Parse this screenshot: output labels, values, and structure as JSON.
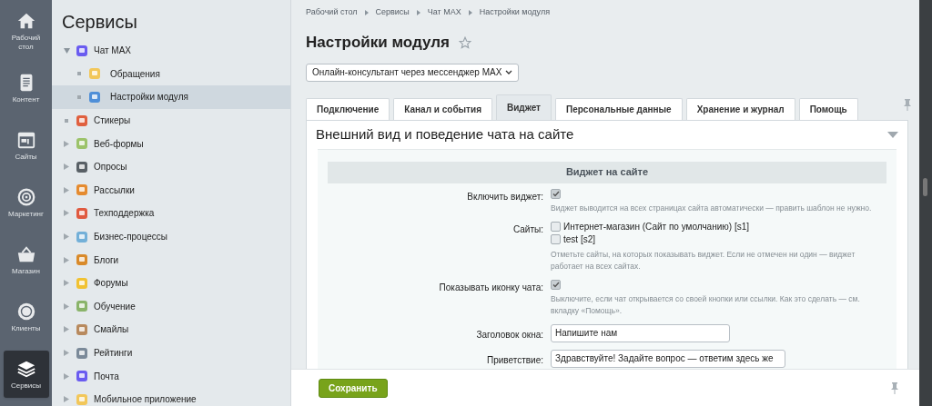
{
  "left_nav": [
    {
      "label": "Рабочий стол",
      "selected": false
    },
    {
      "label": "Контент",
      "selected": false
    },
    {
      "label": "Сайты",
      "selected": false
    },
    {
      "label": "Маркетинг",
      "selected": false
    },
    {
      "label": "Магазин",
      "selected": false
    },
    {
      "label": "Клиенты",
      "selected": false
    },
    {
      "label": "Сервисы",
      "selected": true
    }
  ],
  "sidebar": {
    "title": "Сервисы",
    "items": [
      {
        "label": "Чат MAX",
        "kind": "folder",
        "expanded": true,
        "selected": false,
        "children": [
          {
            "label": "Обращения",
            "kind": "leaf",
            "selected": false
          },
          {
            "label": "Настройки модуля",
            "kind": "leaf",
            "selected": true
          }
        ]
      },
      {
        "label": "Стикеры",
        "kind": "leaf",
        "selected": false
      },
      {
        "label": "Веб-формы",
        "kind": "folder",
        "expanded": false,
        "selected": false
      },
      {
        "label": "Опросы",
        "kind": "folder",
        "expanded": false,
        "selected": false
      },
      {
        "label": "Рассылки",
        "kind": "folder",
        "expanded": false,
        "selected": false
      },
      {
        "label": "Техподдержка",
        "kind": "folder",
        "expanded": false,
        "selected": false
      },
      {
        "label": "Бизнес-процессы",
        "kind": "folder",
        "expanded": false,
        "selected": false
      },
      {
        "label": "Блоги",
        "kind": "folder",
        "expanded": false,
        "selected": false
      },
      {
        "label": "Форумы",
        "kind": "folder",
        "expanded": false,
        "selected": false
      },
      {
        "label": "Обучение",
        "kind": "folder",
        "expanded": false,
        "selected": false
      },
      {
        "label": "Смайлы",
        "kind": "folder",
        "expanded": false,
        "selected": false
      },
      {
        "label": "Рейтинги",
        "kind": "folder",
        "expanded": false,
        "selected": false
      },
      {
        "label": "Почта",
        "kind": "folder",
        "expanded": false,
        "selected": false
      },
      {
        "label": "Мобильное приложение",
        "kind": "folder",
        "expanded": false,
        "selected": false
      }
    ]
  },
  "breadcrumbs": [
    "Рабочий стол",
    "Сервисы",
    "Чат MAX",
    "Настройки модуля"
  ],
  "page_title": "Настройки модуля",
  "module_select": {
    "value": "Онлайн-консультант через мессенджер MAX"
  },
  "tabs": [
    {
      "label": "Подключение",
      "selected": false
    },
    {
      "label": "Канал и события",
      "selected": false
    },
    {
      "label": "Виджет",
      "selected": true
    },
    {
      "label": "Персональные данные",
      "selected": false
    },
    {
      "label": "Хранение и журнал",
      "selected": false
    },
    {
      "label": "Помощь",
      "selected": false
    }
  ],
  "section": {
    "title": "Внешний вид и поведение чата на сайте",
    "expanded": true,
    "group_title": "Виджет на сайте",
    "fields": [
      {
        "kind": "checkbox",
        "label": "Включить виджет:",
        "checked": true,
        "hint": "Виджет выводится на всех страницах сайта автоматически — править шаблон не нужно."
      },
      {
        "kind": "checklist",
        "label": "Сайты:",
        "options": [
          {
            "label": "Интернет-магазин (Сайт по умолчанию) [s1]",
            "checked": false
          },
          {
            "label": "test [s2]",
            "checked": false
          }
        ],
        "hint": "Отметьте сайты, на которых показывать виджет. Если не отмечен ни один — виджет работает на всех сайтах."
      },
      {
        "kind": "checkbox",
        "label": "Показывать иконку чата:",
        "checked": true,
        "hint": "Выключите, если чат открывается со своей кнопки или ссылки. Как это сделать — см. вкладку «Помощь»."
      },
      {
        "kind": "text",
        "label": "Заголовок окна:",
        "value": "Напишите нам"
      },
      {
        "kind": "text",
        "label": "Приветствие:",
        "value": "Здравствуйте! Задайте вопрос — ответим здесь же",
        "wide": true
      }
    ]
  },
  "save_button": "Сохранить"
}
